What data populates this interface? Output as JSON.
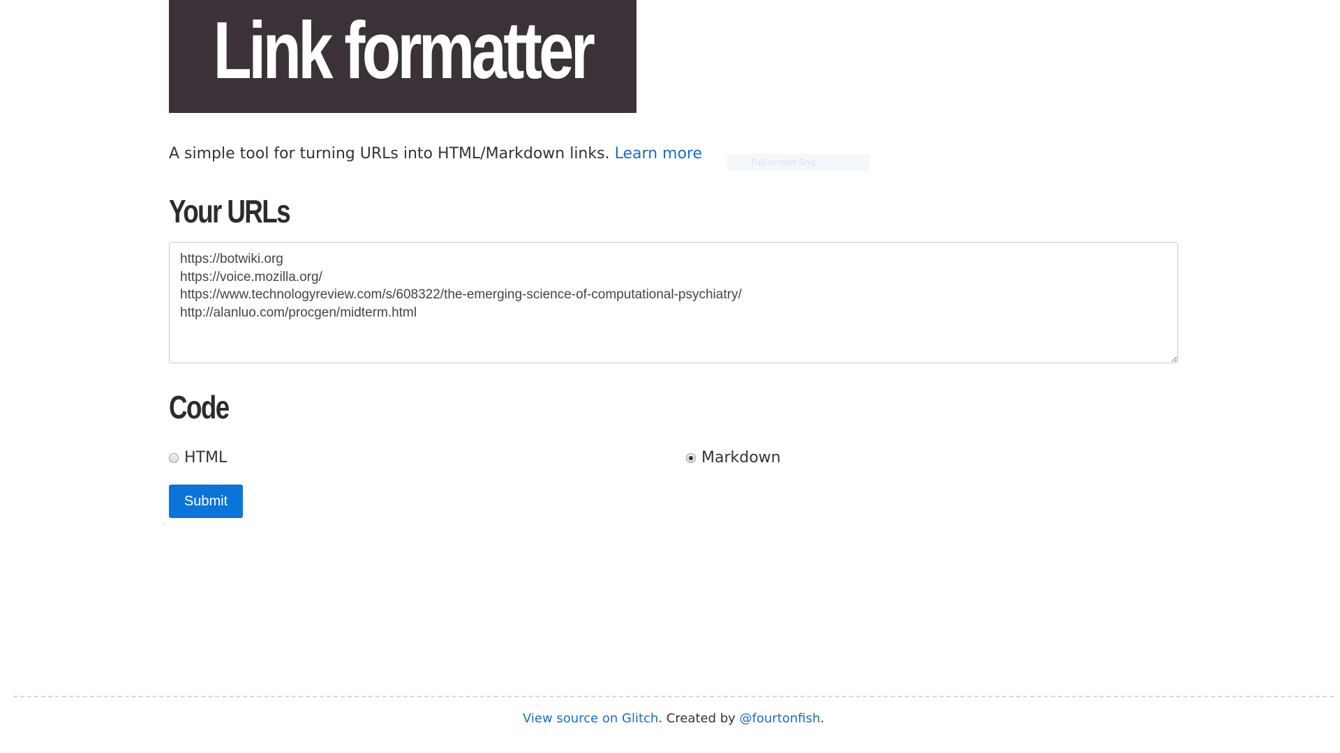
{
  "header": {
    "title": "Link formatter"
  },
  "intro": {
    "text": "A simple tool for turning URLs into HTML/Markdown links.",
    "learn_more": "Learn more"
  },
  "overlay": {
    "snip_label": "Full-screen Snip"
  },
  "urls_section": {
    "title": "Your URLs",
    "value": "https://botwiki.org\nhttps://voice.mozilla.org/\nhttps://www.technologyreview.com/s/608322/the-emerging-science-of-computational-psychiatry/\nhttp://alanluo.com/procgen/midterm.html"
  },
  "code_section": {
    "title": "Code",
    "options": [
      {
        "label": "HTML",
        "selected": false
      },
      {
        "label": "Markdown",
        "selected": true
      }
    ]
  },
  "form": {
    "submit_label": "Submit"
  },
  "footer": {
    "view_source": "View source on Glitch",
    "created_by": ". Created by ",
    "author": "@fourtonfish",
    "end": "."
  },
  "colors": {
    "banner_bg": "#3a3238",
    "link": "#1a6ec7",
    "button": "#0b74d9"
  }
}
